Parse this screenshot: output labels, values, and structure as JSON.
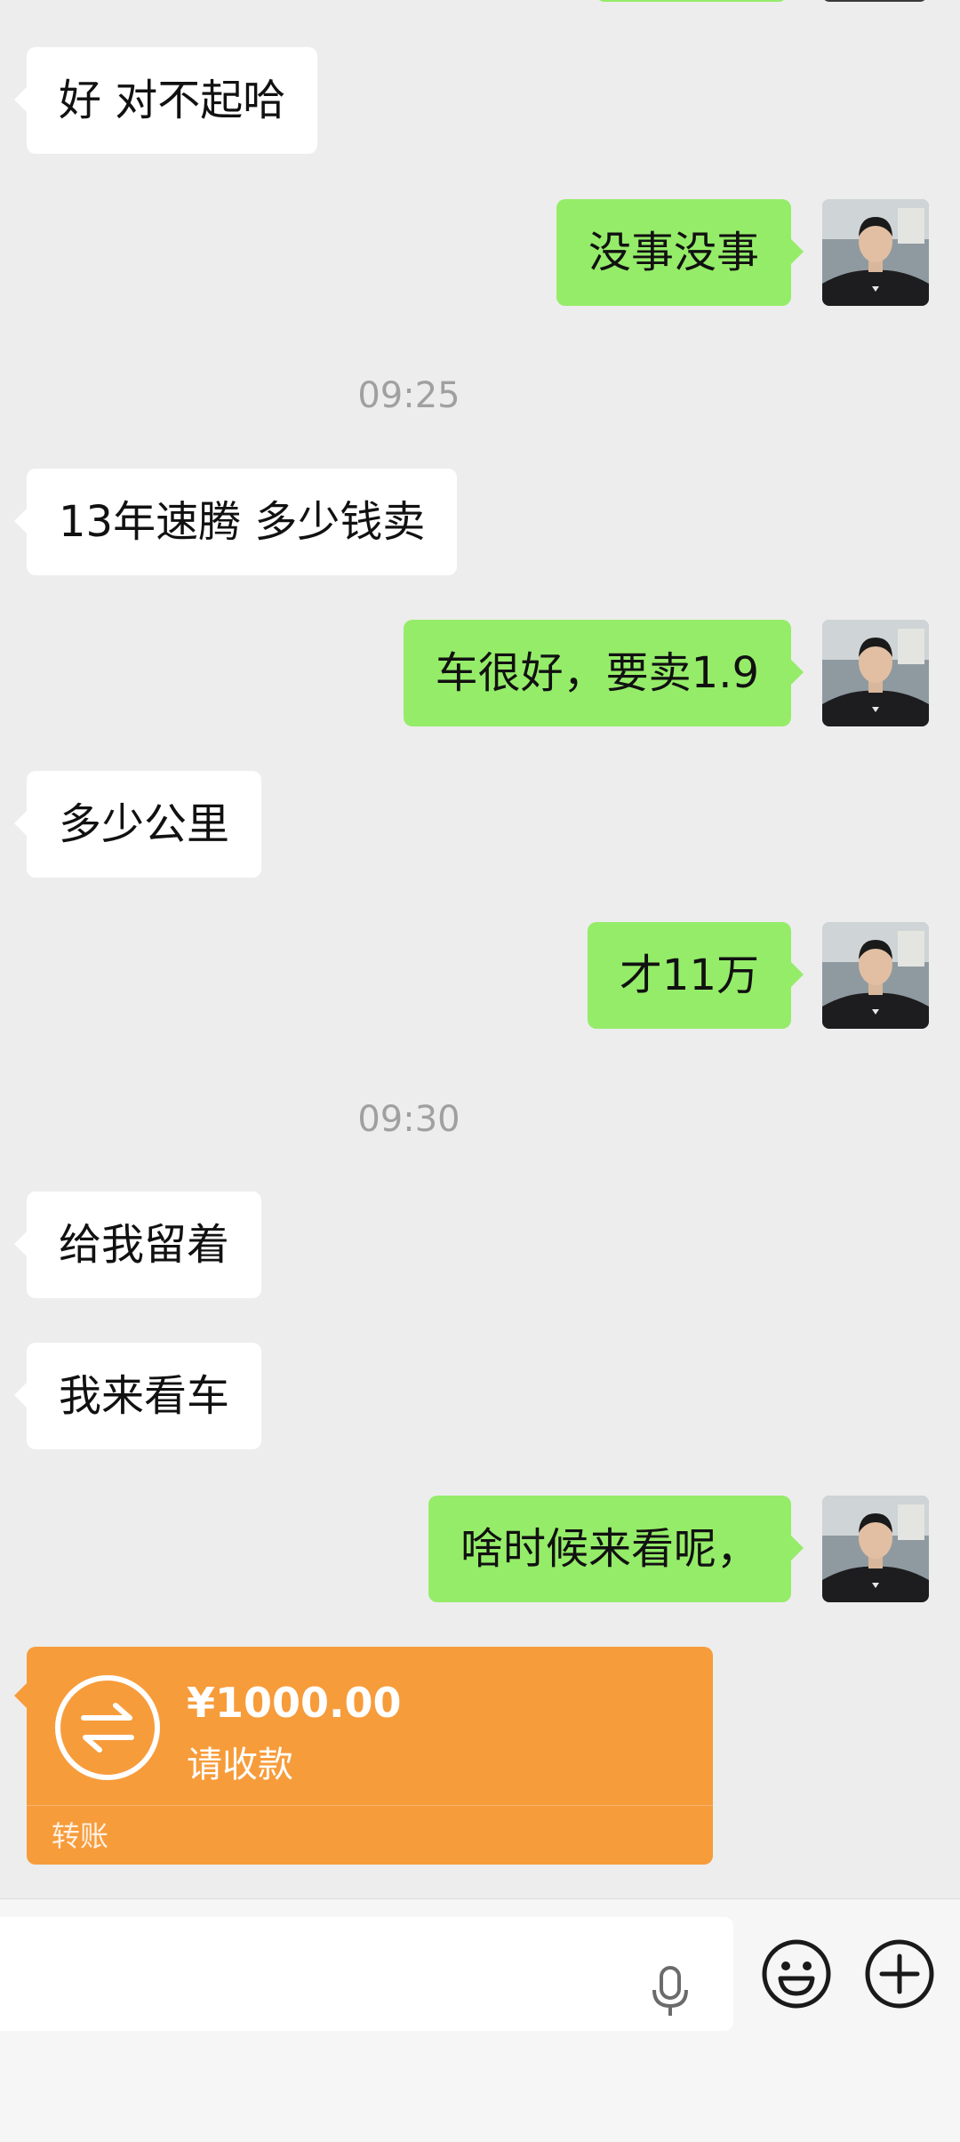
{
  "messages": [
    {
      "side": "left",
      "text": "好 对不起哈"
    },
    {
      "side": "right",
      "text": "没事没事"
    },
    {
      "type": "time",
      "text": "09:25"
    },
    {
      "side": "left",
      "text": "13年速腾 多少钱卖"
    },
    {
      "side": "right",
      "text": "车很好，要卖1.9"
    },
    {
      "side": "left",
      "text": "多少公里"
    },
    {
      "side": "right",
      "text": "才11万"
    },
    {
      "type": "time",
      "text": "09:30"
    },
    {
      "side": "left",
      "text": "给我留着"
    },
    {
      "side": "left",
      "text": "我来看车"
    },
    {
      "side": "right",
      "text": "啥时候来看呢，"
    }
  ],
  "transfer": {
    "amount": "¥1000.00",
    "note": "请收款",
    "label": "转账",
    "color": "#F79C3B"
  },
  "input_bar": {
    "placeholder": "",
    "icons": [
      "microphone-icon",
      "emoji-icon",
      "plus-icon"
    ]
  },
  "colors": {
    "background": "#EDEDED",
    "bubble_self": "#95EC69",
    "bubble_other": "#FFFFFF",
    "timestamp": "#A0A0A0"
  }
}
